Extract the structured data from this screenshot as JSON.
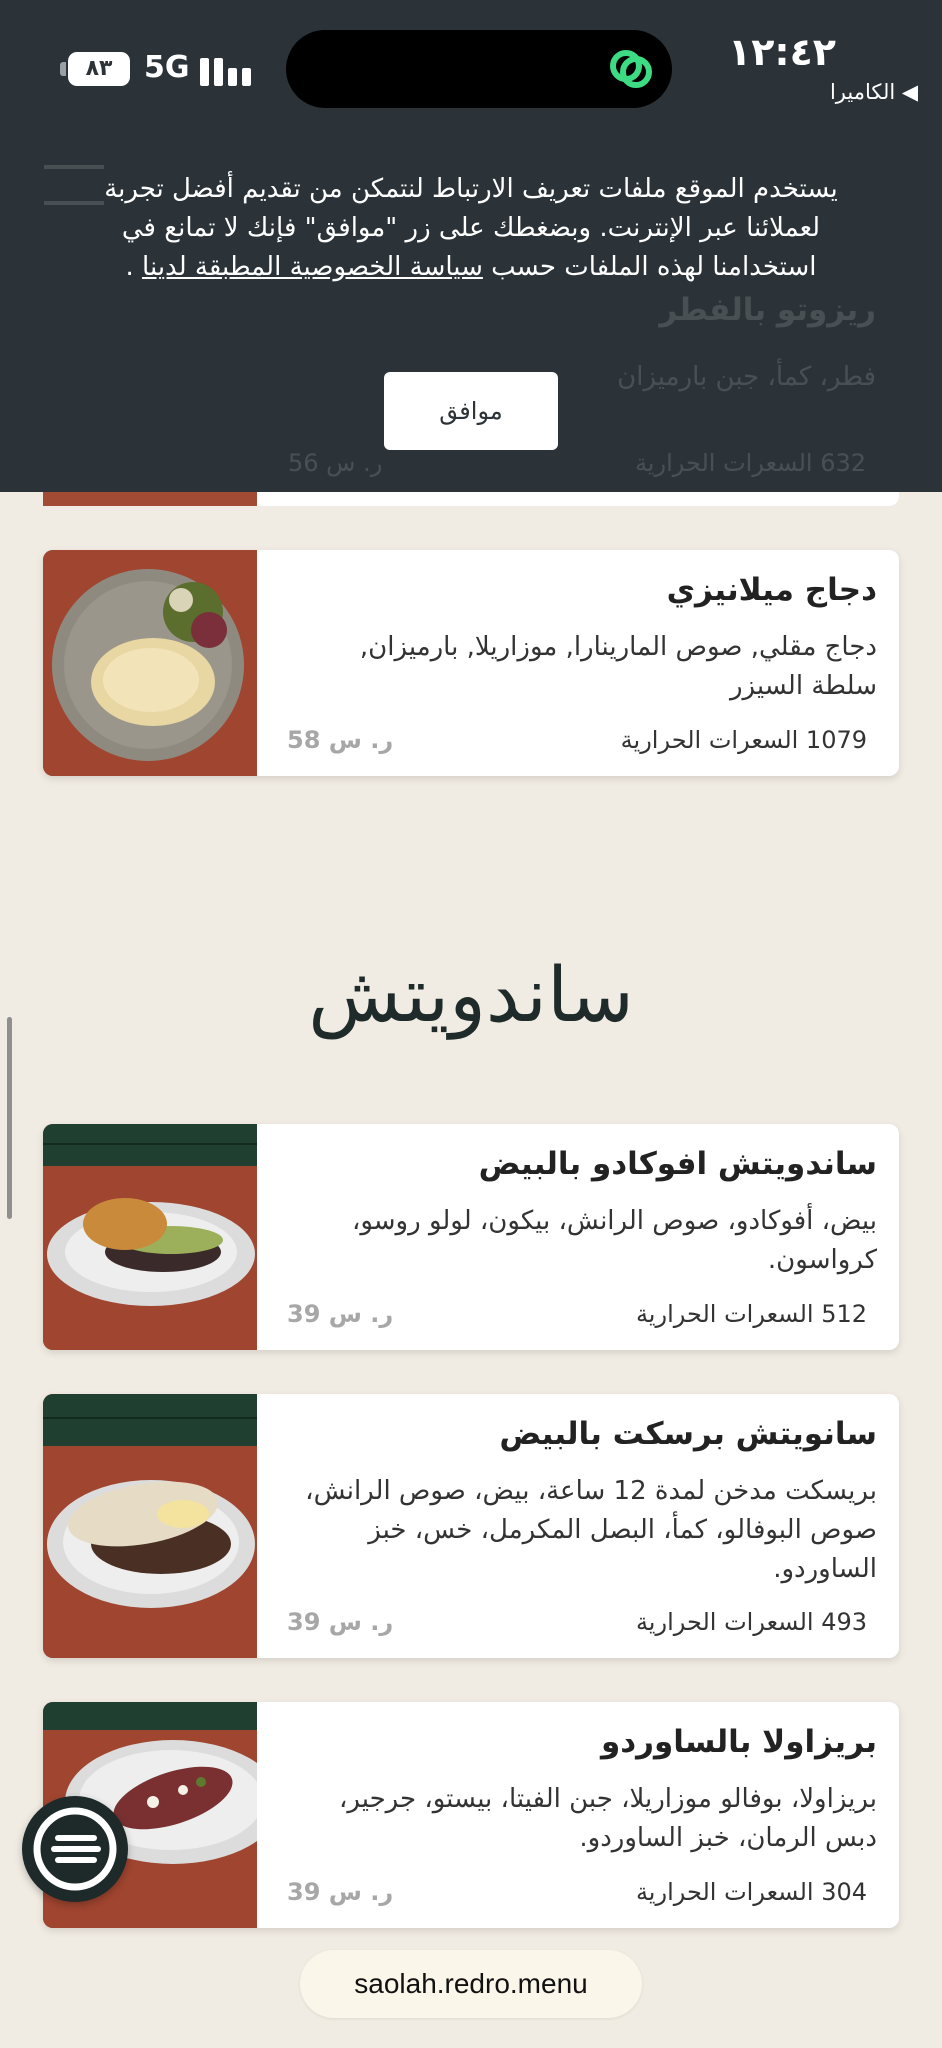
{
  "status_bar": {
    "time": "١٢:٤٢",
    "back_label": "◀ الكاميرا",
    "network": "5G",
    "battery": "٨٣"
  },
  "cookie_banner": {
    "text_before": "يستخدم الموقع ملفات تعريف الارتباط لنتمكن من تقديم أفضل تجربة لعملائنا عبر الإنترنت. وبضغطك على زر \"موافق\" فإنك لا تمانع في استخدامنا لهذه الملفات حسب ",
    "policy_link": "سياسة الخصوصية المطبقة لدينا",
    "text_after": " .",
    "accept_label": "موافق"
  },
  "ghost_item": {
    "name": "ريزوتو بالفطر",
    "desc": "فطر، كمأ، جبن بارميزان",
    "calories": "632 السعرات الحرارية",
    "price": "ر. س 56"
  },
  "items": [
    {
      "name": "دجاج ميلانيزي",
      "desc": "دجاج مقلي, صوص المارينارا, موزاريلا, بارميزان, سلطة السيزر",
      "calories": "1079 السعرات الحرارية",
      "price": "ر. س 58"
    },
    {
      "name": "ساندويتش افوكادو بالبيض",
      "desc": "بيض، أفوكادو، صوص الرانش، بيكون، لولو روسو، كرواسون.",
      "calories": "512 السعرات الحرارية",
      "price": "ر. س 39"
    },
    {
      "name": "سانويتش برسكت بالبيض",
      "desc": "بريسكت مدخن لمدة 12 ساعة، بيض، صوص الرانش، صوص البوفالو، كمأ، البصل المكرمل، خس، خبز الساوردو.",
      "calories": "493 السعرات الحرارية",
      "price": "ر. س 39"
    },
    {
      "name": "بريزاولا بالساوردو",
      "desc": "بريزاولا، بوفالو موزاريلا، جبن الفيتا، بيستو، جرجير، دبس الرمان، خبز الساوردو.",
      "calories": "304 السعرات الحرارية",
      "price": "ر. س 39"
    }
  ],
  "section": {
    "title": "ساندويتش"
  },
  "url": "saolah.redro.menu",
  "colors": {
    "page_bg": "#f1ece3",
    "overlay": "#2b3338",
    "accent_green": "#3ddc84",
    "price_gray": "#a7a7a7",
    "image_wood": "#a14a34"
  }
}
